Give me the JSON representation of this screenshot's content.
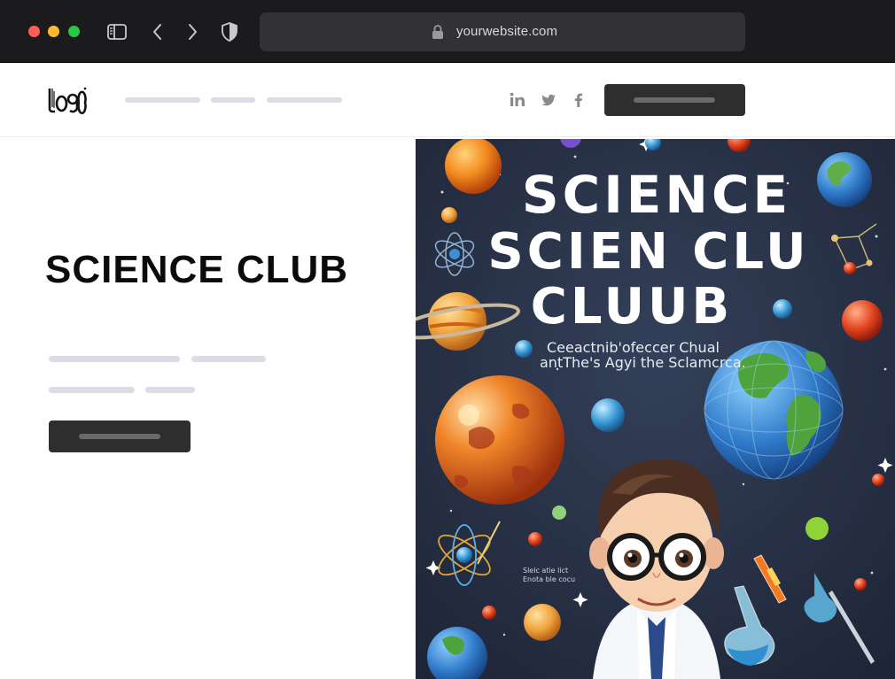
{
  "browser": {
    "url": "yourwebsite.com",
    "traffic_lights": {
      "close": "#fe5f57",
      "minimize": "#febc2e",
      "zoom": "#28c840"
    }
  },
  "header": {
    "logo_text": "LOGO",
    "social": [
      "linkedin-icon",
      "twitter-icon",
      "facebook-icon"
    ]
  },
  "hero": {
    "title": "SCIENCE CLUB"
  },
  "poster": {
    "title_lines": [
      "SCIENCE",
      "SCIEN CLU",
      "CLUUB"
    ],
    "subtitle_lines": [
      "Ceeactnib'ofeccer Chual",
      "antThe's Agyi the Sclamcrca."
    ],
    "small_text_lines": [
      "Slelc atie lict",
      "Enota ble cocu"
    ]
  },
  "colors": {
    "chrome": "#1b1b1d",
    "placeholder": "#dcdbe6",
    "button": "#2e2e2e",
    "poster_bg": "#263043"
  }
}
